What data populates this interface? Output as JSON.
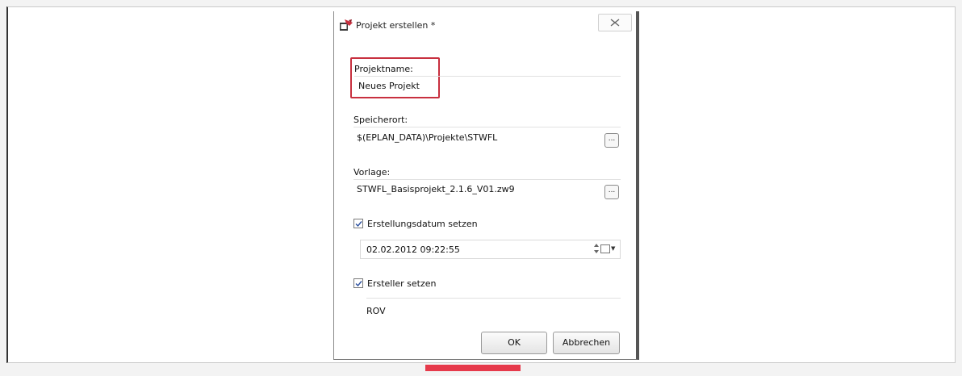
{
  "dialog": {
    "title": "Projekt erstellen *",
    "icons": {
      "app": "project-create-icon",
      "close": "close-icon"
    },
    "project_name": {
      "label": "Projektname:",
      "value": "Neues Projekt"
    },
    "location": {
      "label": "Speicherort:",
      "value": "$(EPLAN_DATA)\\Projekte\\STWFL",
      "browse_label": "..."
    },
    "template": {
      "label": "Vorlage:",
      "value": "STWFL_Basisprojekt_2.1.6_V01.zw9",
      "browse_label": "..."
    },
    "creation_date": {
      "label": "Erstellungsdatum setzen",
      "checked": true,
      "value": "02.02.2012 09:22:55"
    },
    "creator": {
      "label": "Ersteller setzen",
      "checked": true,
      "value": "ROV"
    },
    "buttons": {
      "ok": "OK",
      "cancel": "Abbrechen"
    },
    "colors": {
      "highlight": "#c8303f",
      "accent": "#e63a4b"
    }
  }
}
